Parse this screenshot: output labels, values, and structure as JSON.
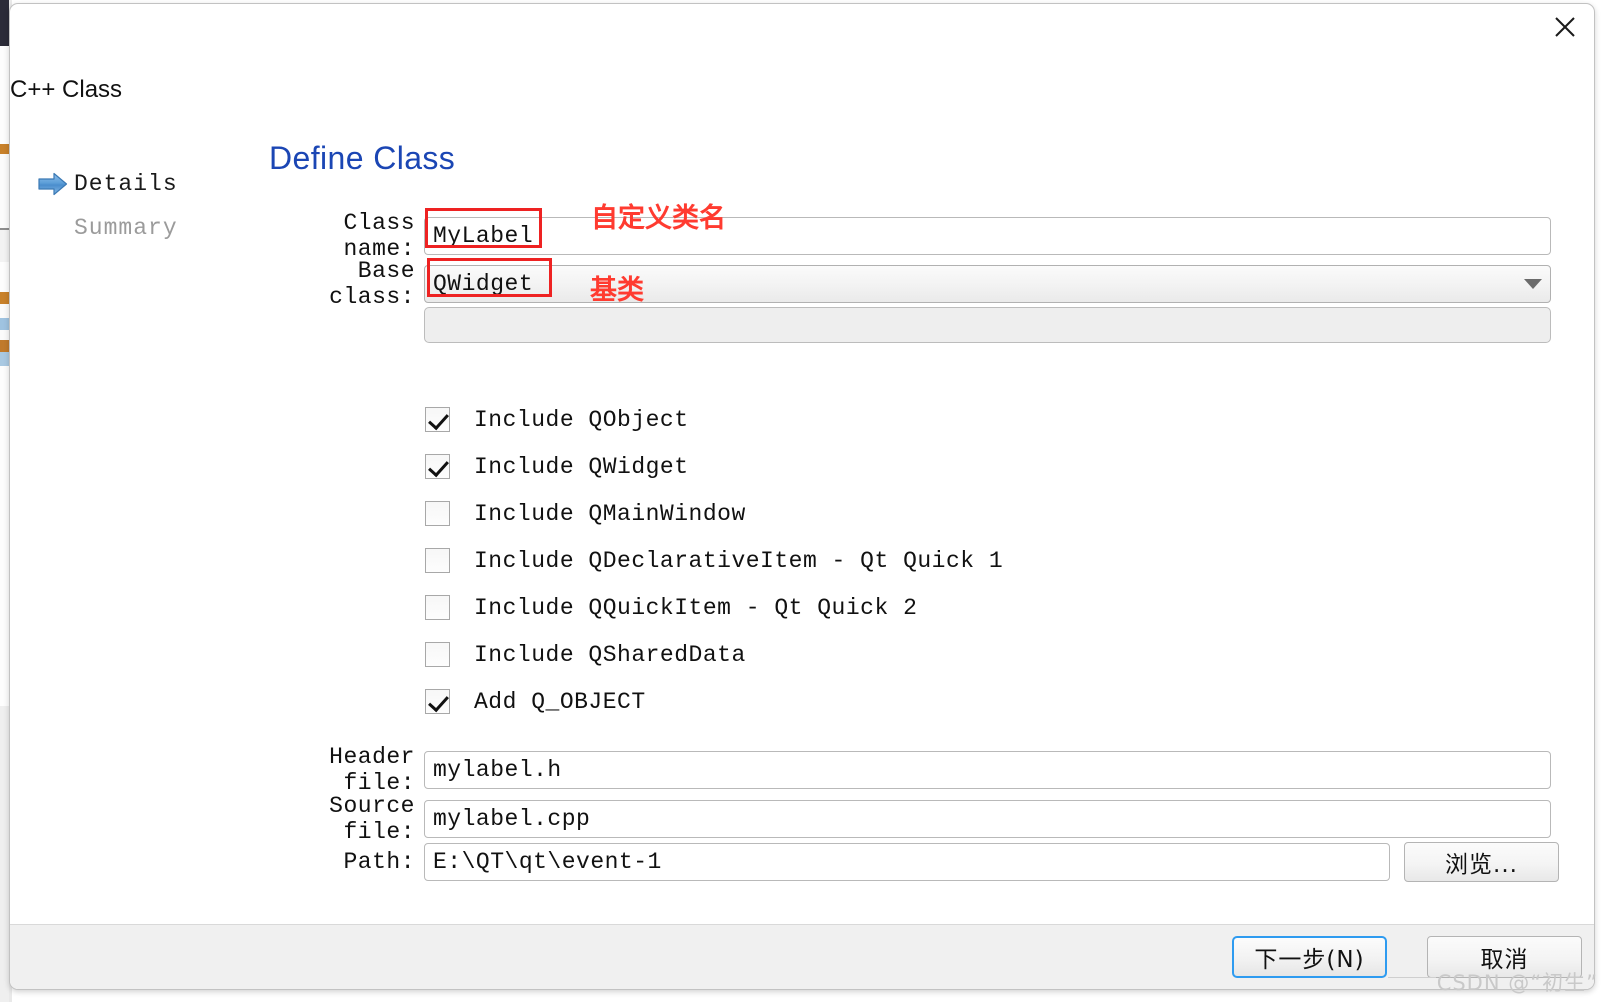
{
  "window": {
    "wizard_title": "C++ Class",
    "close_icon": "close-icon"
  },
  "nav": {
    "items": [
      {
        "label": "Details",
        "active": true,
        "icon": "blue-right-arrow-icon"
      },
      {
        "label": "Summary",
        "active": false,
        "icon": ""
      }
    ]
  },
  "page": {
    "heading": "Define Class"
  },
  "form": {
    "class_name": {
      "label": "Class name:",
      "value": "MyLabel"
    },
    "base_class": {
      "label": "Base class:",
      "value": "QWidget",
      "dropdown_icon": "chevron-down-icon"
    },
    "extra_field": {
      "value": ""
    },
    "header_file": {
      "label": "Header file:",
      "value": "mylabel.h"
    },
    "source_file": {
      "label": "Source file:",
      "value": "mylabel.cpp"
    },
    "path": {
      "label": "Path:",
      "value": "E:\\QT\\qt\\event-1"
    },
    "browse_button": "浏览..."
  },
  "checkboxes": [
    {
      "label": "Include QObject",
      "checked": true
    },
    {
      "label": "Include QWidget",
      "checked": true
    },
    {
      "label": "Include QMainWindow",
      "checked": false
    },
    {
      "label": "Include QDeclarativeItem - Qt Quick 1",
      "checked": false
    },
    {
      "label": "Include QQuickItem - Qt Quick 2",
      "checked": false
    },
    {
      "label": "Include QSharedData",
      "checked": false
    },
    {
      "label": "Add Q_OBJECT",
      "checked": true
    }
  ],
  "annotations": {
    "class_name_note": "自定义类名",
    "base_class_note": "基类",
    "color": "#ff3b30"
  },
  "footer": {
    "next_button": "下一步(N)",
    "cancel_button": "取消"
  },
  "watermark": "CSDN @“初生”"
}
